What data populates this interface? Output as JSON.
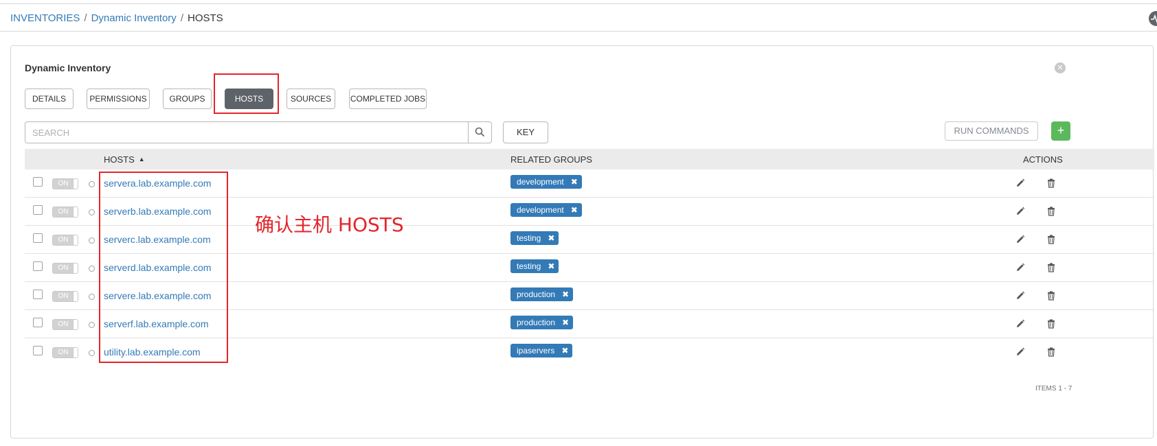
{
  "breadcrumb": {
    "items": [
      "INVENTORIES",
      "Dynamic Inventory",
      "HOSTS"
    ],
    "separator": "/"
  },
  "panel": {
    "title": "Dynamic Inventory"
  },
  "tabs": [
    {
      "label": "DETAILS"
    },
    {
      "label": "PERMISSIONS"
    },
    {
      "label": "GROUPS"
    },
    {
      "label": "HOSTS",
      "active": true
    },
    {
      "label": "SOURCES"
    },
    {
      "label": "COMPLETED JOBS"
    }
  ],
  "search": {
    "placeholder": "SEARCH",
    "value": ""
  },
  "toolbar": {
    "key_label": "KEY",
    "run_commands_label": "RUN COMMANDS",
    "add_label": "+"
  },
  "table": {
    "columns": {
      "hosts": "HOSTS",
      "related_groups": "RELATED GROUPS",
      "actions": "ACTIONS"
    },
    "sort_indicator": "▲",
    "rows": [
      {
        "toggle": "ON",
        "host": "servera.lab.example.com",
        "group": "development"
      },
      {
        "toggle": "ON",
        "host": "serverb.lab.example.com",
        "group": "development"
      },
      {
        "toggle": "ON",
        "host": "serverc.lab.example.com",
        "group": "testing"
      },
      {
        "toggle": "ON",
        "host": "serverd.lab.example.com",
        "group": "testing"
      },
      {
        "toggle": "ON",
        "host": "servere.lab.example.com",
        "group": "production"
      },
      {
        "toggle": "ON",
        "host": "serverf.lab.example.com",
        "group": "production"
      },
      {
        "toggle": "ON",
        "host": "utility.lab.example.com",
        "group": "ipaservers"
      }
    ]
  },
  "annotation": {
    "text": "确认主机 HOSTS",
    "color": "#e3242b"
  },
  "footer": {
    "items_count": "ITEMS  1 - 7"
  },
  "colors": {
    "link": "#337ab7",
    "tab_active_bg": "#5e636a",
    "add_button": "#5cb85c",
    "tag_bg": "#337ab7",
    "highlight": "#e3242b"
  }
}
